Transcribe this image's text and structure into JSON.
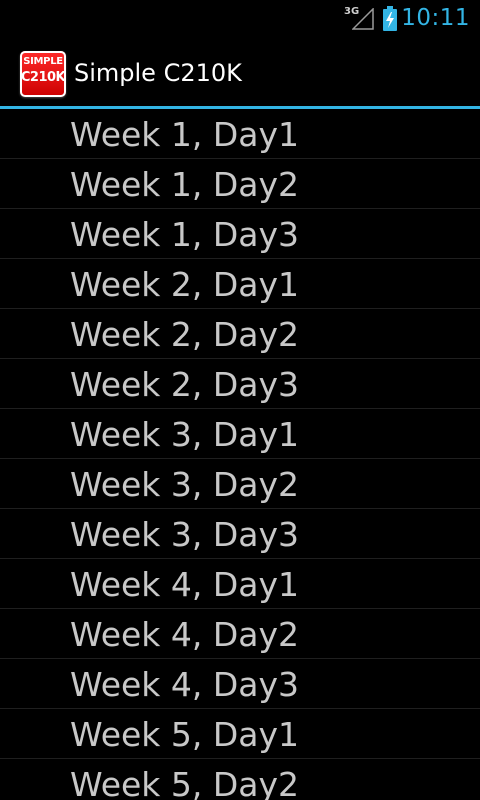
{
  "status_bar": {
    "network": "3G",
    "time": "10:11",
    "signal_icon": "signal-empty-icon",
    "battery_icon": "battery-charging-icon",
    "accent_color": "#33b5e5"
  },
  "action_bar": {
    "app_icon": {
      "line1": "SIMPLE",
      "line2": "C210K",
      "color": "#e60000"
    },
    "title": "Simple C210K",
    "divider_color": "#33b5e5"
  },
  "list": {
    "items": [
      {
        "label": "Week 1, Day1"
      },
      {
        "label": "Week 1, Day2"
      },
      {
        "label": "Week 1, Day3"
      },
      {
        "label": "Week 2, Day1"
      },
      {
        "label": "Week 2, Day2"
      },
      {
        "label": "Week 2, Day3"
      },
      {
        "label": "Week 3, Day1"
      },
      {
        "label": "Week 3, Day2"
      },
      {
        "label": "Week 3, Day3"
      },
      {
        "label": "Week 4, Day1"
      },
      {
        "label": "Week 4, Day2"
      },
      {
        "label": "Week 4, Day3"
      },
      {
        "label": "Week 5, Day1"
      },
      {
        "label": "Week 5, Day2"
      }
    ]
  }
}
